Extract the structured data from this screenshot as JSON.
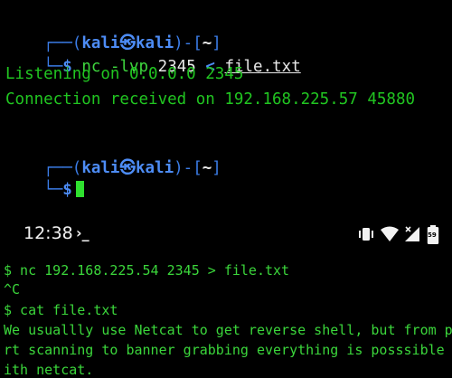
{
  "kali_terminal": {
    "prompt1": {
      "open": "┌──(",
      "user": "kali",
      "at": "㉿",
      "host": "kali",
      "close": ")-[",
      "dir": "~",
      "end": "]",
      "corner": "└─",
      "dollar": "$",
      "cmd": "nc",
      "flag": "-lvp",
      "port": "2345",
      "redir": "<",
      "file": "file.txt"
    },
    "output": [
      "Listening on 0.0.0.0 2345",
      "Connection received on 192.168.225.57 45880"
    ],
    "prompt2": {
      "open": "┌──(",
      "user": "kali",
      "at": "㉿",
      "host": "kali",
      "close": ")-[",
      "dir": "~",
      "end": "]",
      "corner": "└─",
      "dollar": "$"
    }
  },
  "phone": {
    "status_bar": {
      "time": "12:38",
      "terminal_indicator": "›_",
      "battery_text": "59"
    },
    "lines": [
      "$ nc 192.168.225.54 2345 > file.txt",
      "^C",
      "$ cat file.txt",
      "We usuallly use Netcat to get reverse shell, but from p",
      "rt scanning to banner grabbing everything is posssible w",
      "ith netcat."
    ]
  },
  "colors": {
    "kali_green": "#21c521",
    "kali_blue": "#4d8cf5",
    "termux_green": "#3bd63b"
  }
}
